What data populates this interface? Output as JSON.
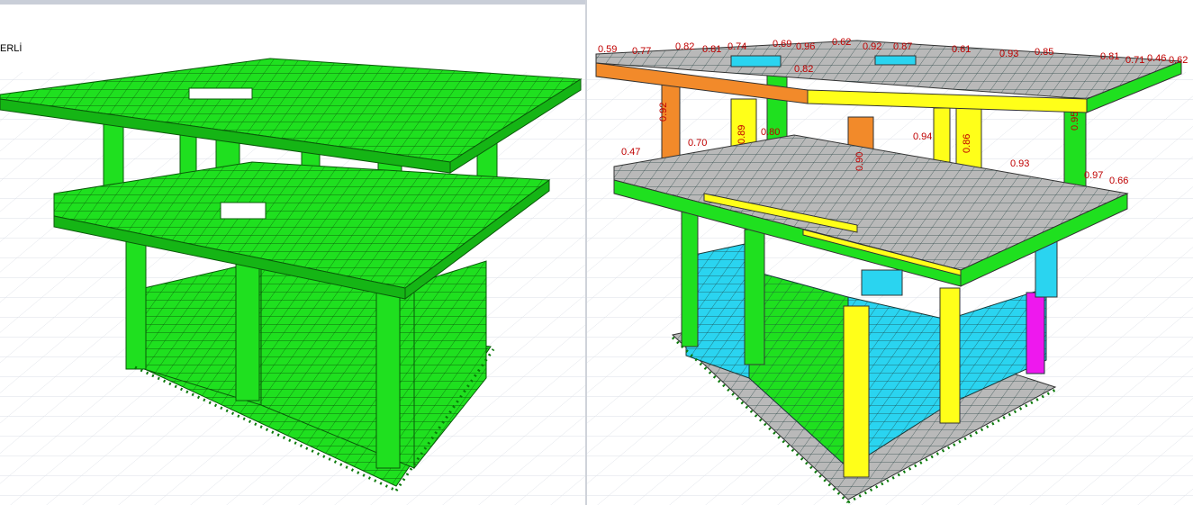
{
  "left_viewport": {
    "status_label": "ERLİ",
    "model_color": "#1fe01f"
  },
  "right_viewport": {
    "ratio_color": "#c00000",
    "ratio_labels": [
      "0.59",
      "0.77",
      "0.82",
      "0.81",
      "0.74",
      "0.69",
      "0.96",
      "0.62",
      "0.92",
      "0.87",
      "0.61",
      "0.93",
      "0.85",
      "0.81",
      "0.71",
      "0.46",
      "0.62",
      "0.92",
      "0.89",
      "0.47",
      "0.70",
      "0.80",
      "0.90",
      "0.86",
      "0.95",
      "0.94",
      "0.93",
      "0.82",
      "0.66",
      "0.97"
    ],
    "colors": {
      "green": "#1fe01f",
      "orange": "#f28a2a",
      "yellow": "#ffff19",
      "cyan": "#2ad4f0",
      "magenta": "#ee18ee",
      "grey": "#b9b9b9"
    }
  }
}
